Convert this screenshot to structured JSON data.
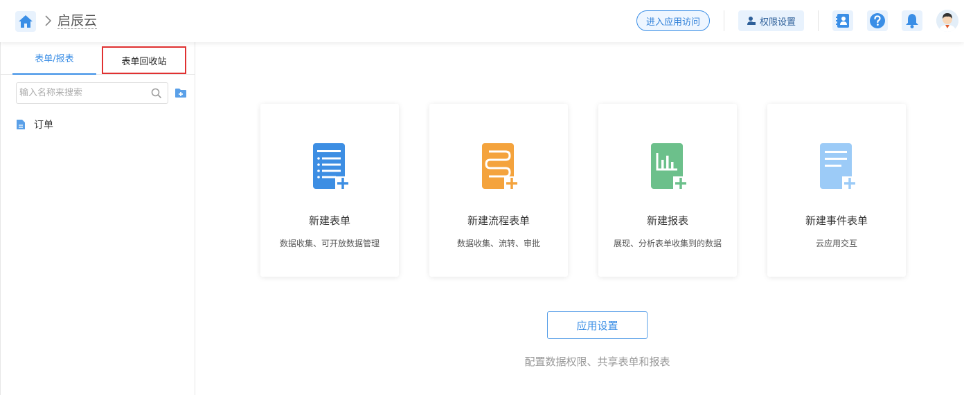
{
  "header": {
    "home_icon": "home-icon",
    "app_title": "启辰云",
    "visit_label": "进入应用访问",
    "permission_label": "权限设置",
    "icons": [
      "contacts-icon",
      "help-icon",
      "bell-icon",
      "avatar"
    ]
  },
  "sidebar": {
    "tabs": [
      {
        "label": "表单/报表",
        "active": true
      },
      {
        "label": "表单回收站",
        "active": false,
        "highlighted": true
      }
    ],
    "search_placeholder": "输入名称来搜索",
    "items": [
      {
        "label": "订单",
        "icon": "document-icon"
      }
    ]
  },
  "main": {
    "cards": [
      {
        "title": "新建表单",
        "desc": "数据收集、可开放数据管理",
        "icon": "form-icon",
        "color": "#3d8ee3"
      },
      {
        "title": "新建流程表单",
        "desc": "数据收集、流转、审批",
        "icon": "flow-form-icon",
        "color": "#f4a33d"
      },
      {
        "title": "新建报表",
        "desc": "展现、分析表单收集到的数据",
        "icon": "report-icon",
        "color": "#6cc08b"
      },
      {
        "title": "新建事件表单",
        "desc": "云应用交互",
        "icon": "event-form-icon",
        "color": "#9ccbf7"
      }
    ],
    "settings_button": "应用设置",
    "settings_desc": "配置数据权限、共享表单和报表"
  },
  "colors": {
    "accent": "#3a8ee6",
    "highlight_border": "#e03131"
  }
}
